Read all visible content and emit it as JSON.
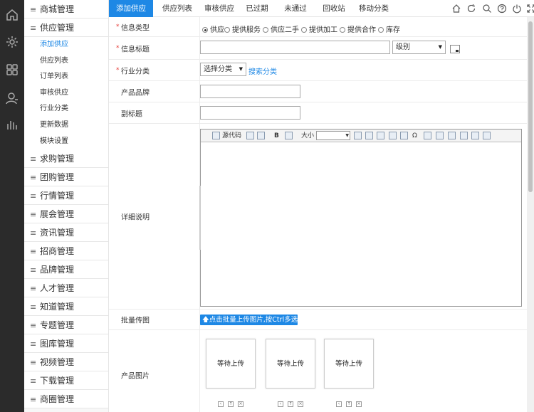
{
  "rail": {
    "icons": [
      "home-icon",
      "gear-icon",
      "grid-icon",
      "user-icon",
      "stats-icon"
    ]
  },
  "sidebar": {
    "groups": [
      {
        "label": "商城管理"
      },
      {
        "label": "供应管理"
      },
      {
        "label": "求购管理"
      },
      {
        "label": "团购管理"
      },
      {
        "label": "行情管理"
      },
      {
        "label": "展会管理"
      },
      {
        "label": "资讯管理"
      },
      {
        "label": "招商管理"
      },
      {
        "label": "品牌管理"
      },
      {
        "label": "人才管理"
      },
      {
        "label": "知道管理"
      },
      {
        "label": "专题管理"
      },
      {
        "label": "图库管理"
      },
      {
        "label": "视频管理"
      },
      {
        "label": "下载管理"
      },
      {
        "label": "商圈管理"
      }
    ],
    "supply_sub": [
      {
        "label": "添加供应",
        "active": true
      },
      {
        "label": "供应列表"
      },
      {
        "label": "订单列表"
      },
      {
        "label": "审核供应"
      },
      {
        "label": "行业分类"
      },
      {
        "label": "更新数据"
      },
      {
        "label": "模块设置"
      }
    ]
  },
  "tabs": [
    {
      "label": "添加供应",
      "active": true
    },
    {
      "label": "供应列表"
    },
    {
      "label": "审核供应"
    },
    {
      "label": "已过期"
    },
    {
      "label": "未通过"
    },
    {
      "label": "回收站"
    },
    {
      "label": "移动分类"
    }
  ],
  "toolbar_icons": [
    "home-icon",
    "refresh-icon",
    "search-icon",
    "help-icon",
    "power-icon",
    "fullscreen-icon"
  ],
  "form": {
    "info_type": {
      "label": "信息类型",
      "options": [
        "供应",
        "提供服务",
        "供应二手",
        "提供加工",
        "提供合作",
        "库存"
      ],
      "selected": "供应"
    },
    "title": {
      "label": "信息标题",
      "value": "",
      "level_select": "级别"
    },
    "category": {
      "label": "行业分类",
      "select": "选择分类",
      "search_link": "搜索分类"
    },
    "brand": {
      "label": "产品品牌",
      "value": ""
    },
    "subtitle": {
      "label": "副标题",
      "value": ""
    },
    "detail": {
      "label": "详细说明",
      "toolbar": {
        "source": "源代码",
        "bold": "B",
        "font_size": "大小"
      }
    },
    "batch_upload": {
      "label": "批量传图",
      "button": "点击批量上传图片,按Ctrl多选"
    },
    "product_images": {
      "label": "产品图片",
      "slots": [
        "等待上传",
        "等待上传",
        "等待上传"
      ]
    }
  }
}
